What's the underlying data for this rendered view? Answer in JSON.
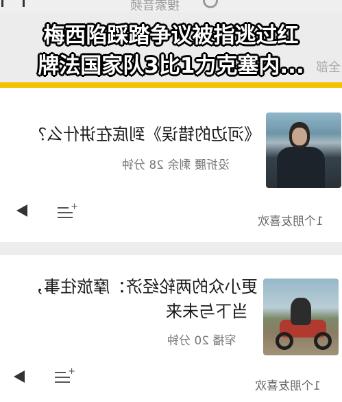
{
  "header": {
    "search_placeholder": "搜索音频",
    "headline_line1": "梅西陷踩踏争议被指逃过红",
    "headline_line2": "牌法国家队3比1力克塞内...",
    "corner_fragment": "全部"
  },
  "cards": [
    {
      "title": "《河边的错误》到底在讲什么？",
      "meta": "没折腰  剩余 28 分钟",
      "likes": "1个朋友喜欢",
      "thumb": "man-portrait-by-water"
    },
    {
      "title_line1": "更小众的两轮经济：摩旅往事，",
      "title_line2": "当下与未来",
      "meta": "窄播  20 分钟",
      "likes": "1个朋友喜欢",
      "thumb": "motorcycle-rider"
    }
  ],
  "colors": {
    "accent": "#f2c200",
    "card": "#ffffff",
    "background": "#ededed"
  }
}
